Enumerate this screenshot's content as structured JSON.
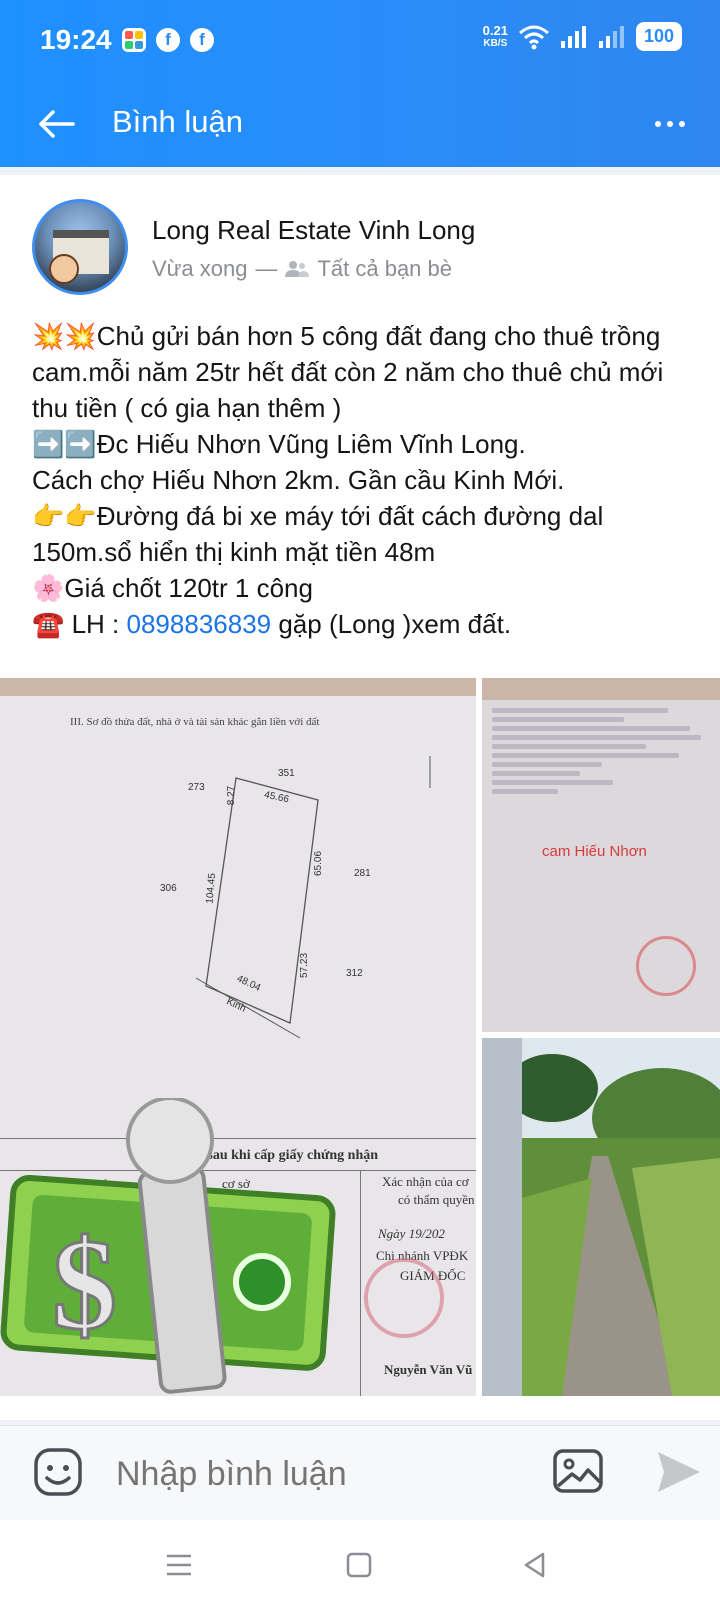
{
  "status_bar": {
    "time": "19:24",
    "net_speed_value": "0.21",
    "net_speed_unit": "KB/S",
    "battery": "100",
    "notification_icons": [
      "multicolor-app-icon",
      "facebook-icon",
      "facebook-icon"
    ]
  },
  "app_bar": {
    "title": "Bình luận"
  },
  "post": {
    "author": "Long Real Estate Vinh Long",
    "time": "Vừa xong",
    "separator": "—",
    "audience": "Tất cả bạn bè",
    "content_before_phone": "💥💥Chủ gửi bán hơn 5 công đất đang cho thuê trồng cam.mỗi năm 25tr hết đất còn 2 năm cho thuê chủ mới thu tiền ( có gia hạn thêm )\n➡️➡️Đc Hiếu Nhơn Vũng Liêm Vĩnh Long.\nCách chợ Hiếu Nhơn 2km. Gần cầu Kinh Mới.\n👉👉Đường đá bi xe máy tới đất cách đường dal 150m.sổ hiển thị kinh mặt tiền 48m\n🌸Giá chốt 120tr 1 công\n☎️ LH : ",
    "phone": "0898836839",
    "content_after_phone": " gặp (Long )xem đất."
  },
  "images": {
    "main_doc": {
      "heading": "III. Sơ đồ thửa đất, nhà ở và tài sản khác gắn liền với đất",
      "labels": {
        "n351": "351",
        "n273": "273",
        "n827": "8.27",
        "n4566": "45.66",
        "n306": "306",
        "n10445": "104.45",
        "n6506": "65.06",
        "n281": "281",
        "n5723": "57.23",
        "n312": "312",
        "n4804": "48.04",
        "kinh": "Kinh"
      },
      "lower_title": "i sau khi cấp giấy chứng nhận",
      "col_noidung": "Nội dung",
      "col_coso": "cơ sở",
      "col_xacnhan1": "Xác nhận của cơ",
      "col_xacnhan2": "có thẩm quyền",
      "ngay": "Ngày",
      "ngay_value": "19/202",
      "chi_nhanh": "Chi nhánh VPĐK",
      "giam_doc": "GIÁM ĐỐC",
      "signer": "Nguyễn Văn Vũ"
    },
    "side_doc": {
      "overlay": "cam Hiếu Nhơn"
    }
  },
  "comment_bar": {
    "placeholder": "Nhập bình luận"
  }
}
